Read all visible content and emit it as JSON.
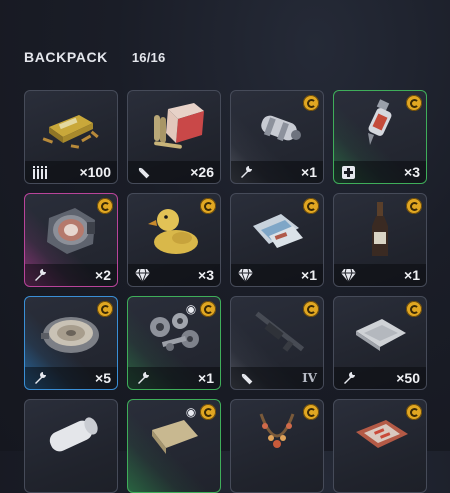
{
  "header": {
    "title": "BACKPACK",
    "count": "16/16"
  },
  "colors": {
    "coin": "#e1a722",
    "rarity_green": "#3fae5a",
    "rarity_pink": "#b9449a",
    "rarity_blue": "#3a8fd6"
  },
  "slots": [
    {
      "item_icon": "ammo-box-icon",
      "category_icon": "ammo-icon",
      "quantity": "×100",
      "tier": "",
      "coin": false,
      "eye": false,
      "rarity": "none"
    },
    {
      "item_icon": "ammo-crate-icon",
      "category_icon": "bullet-icon",
      "quantity": "×26",
      "tier": "",
      "coin": false,
      "eye": false,
      "rarity": "none"
    },
    {
      "item_icon": "battery-cell-icon",
      "category_icon": "wrench-icon",
      "quantity": "×1",
      "tier": "",
      "coin": true,
      "eye": false,
      "rarity": "grey"
    },
    {
      "item_icon": "injector-icon",
      "category_icon": "medkit-icon",
      "quantity": "×3",
      "tier": "",
      "coin": true,
      "eye": false,
      "rarity": "green"
    },
    {
      "item_icon": "reactor-core-icon",
      "category_icon": "wrench-icon",
      "quantity": "×2",
      "tier": "",
      "coin": true,
      "eye": false,
      "rarity": "pink"
    },
    {
      "item_icon": "rubber-duck-icon",
      "category_icon": "gem-icon",
      "quantity": "×3",
      "tier": "",
      "coin": true,
      "eye": false,
      "rarity": "none"
    },
    {
      "item_icon": "map-fragments-icon",
      "category_icon": "gem-icon",
      "quantity": "×1",
      "tier": "",
      "coin": true,
      "eye": false,
      "rarity": "none"
    },
    {
      "item_icon": "bottle-icon",
      "category_icon": "gem-icon",
      "quantity": "×1",
      "tier": "",
      "coin": true,
      "eye": false,
      "rarity": "none"
    },
    {
      "item_icon": "speaker-icon",
      "category_icon": "wrench-icon",
      "quantity": "×5",
      "tier": "",
      "coin": true,
      "eye": false,
      "rarity": "blue"
    },
    {
      "item_icon": "gears-icon",
      "category_icon": "wrench-icon",
      "quantity": "×1",
      "tier": "",
      "coin": true,
      "eye": true,
      "rarity": "green"
    },
    {
      "item_icon": "rifle-icon",
      "category_icon": "bullet-icon",
      "quantity": "",
      "tier": "IV",
      "coin": true,
      "eye": false,
      "rarity": "grey"
    },
    {
      "item_icon": "fabric-icon",
      "category_icon": "wrench-icon",
      "quantity": "×50",
      "tier": "",
      "coin": true,
      "eye": false,
      "rarity": "none"
    },
    {
      "item_icon": "bandage-icon",
      "category_icon": "",
      "quantity": "",
      "tier": "",
      "coin": false,
      "eye": false,
      "rarity": "none"
    },
    {
      "item_icon": "cloth-roll-icon",
      "category_icon": "",
      "quantity": "",
      "tier": "",
      "coin": true,
      "eye": true,
      "rarity": "green"
    },
    {
      "item_icon": "necklace-icon",
      "category_icon": "",
      "quantity": "",
      "tier": "",
      "coin": true,
      "eye": false,
      "rarity": "none"
    },
    {
      "item_icon": "circuit-board-icon",
      "category_icon": "",
      "quantity": "",
      "tier": "",
      "coin": true,
      "eye": false,
      "rarity": "none"
    }
  ]
}
